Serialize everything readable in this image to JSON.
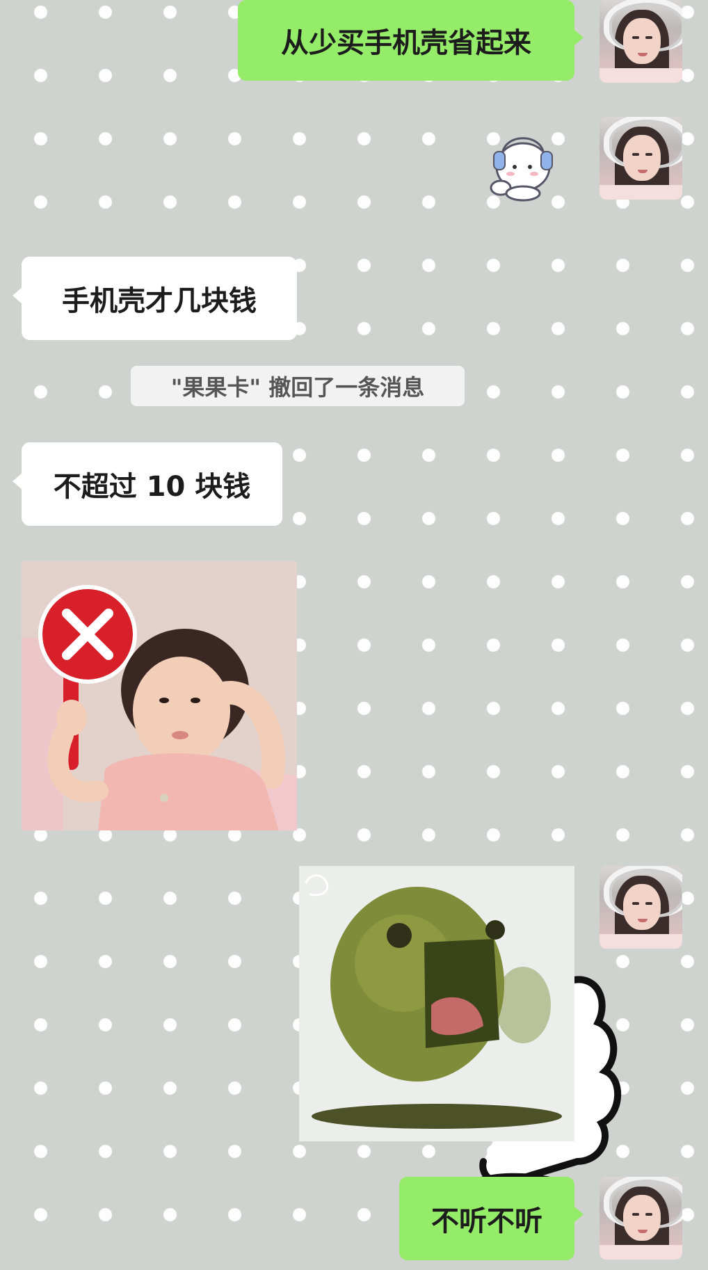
{
  "conversation": {
    "messages": [
      {
        "sender": "me",
        "type": "text",
        "text": "从少买手机壳省起来"
      },
      {
        "sender": "me",
        "type": "sticker",
        "icon": "headphone-cat-sticker"
      },
      {
        "sender": "them",
        "type": "text",
        "text": "手机壳才几块钱"
      },
      {
        "sender": "system",
        "type": "recall",
        "text": "\"果果卡\" 撤回了一条消息"
      },
      {
        "sender": "them",
        "type": "text",
        "text": "不超过 10 块钱"
      },
      {
        "sender": "them",
        "type": "image",
        "icon": "child-red-x-sign-photo"
      },
      {
        "sender": "me",
        "type": "image",
        "icon": "green-blob-screaming-sticker"
      },
      {
        "sender": "me",
        "type": "text",
        "text": "不听不听"
      }
    ]
  },
  "colors": {
    "outgoing_bubble": "#95ec69",
    "incoming_bubble": "#ffffff",
    "chat_background": "#cfd3cf"
  }
}
